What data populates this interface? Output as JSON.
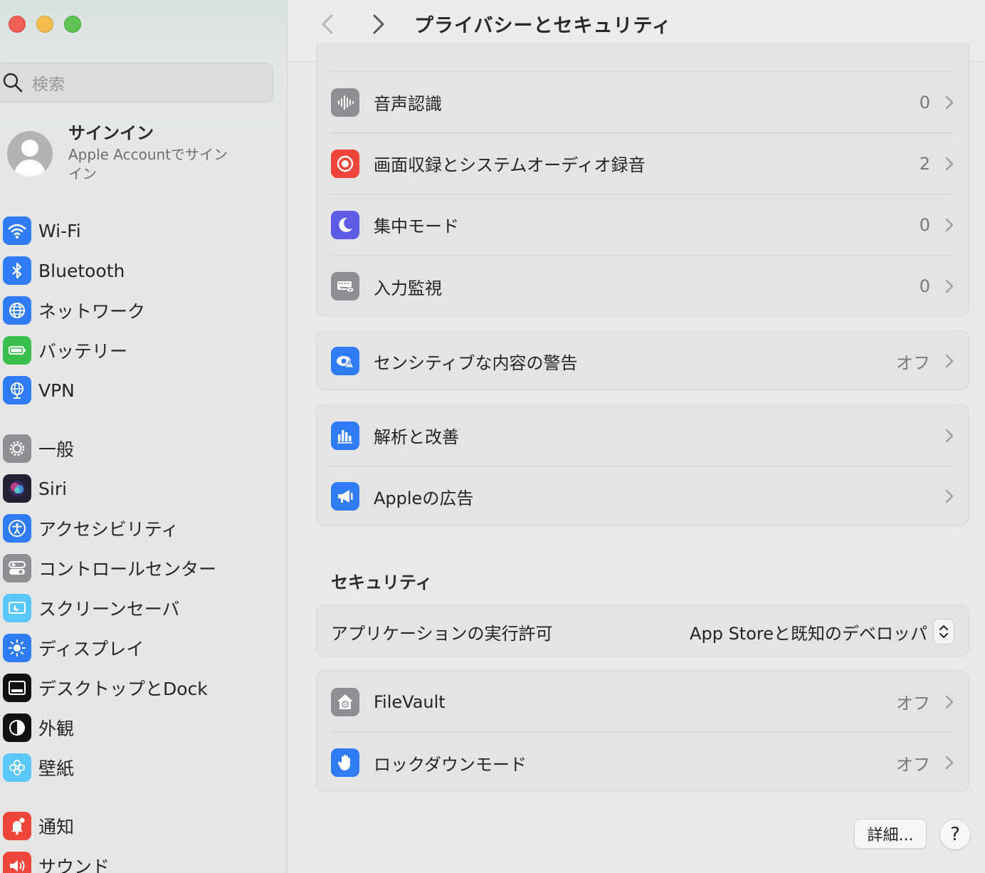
{
  "window": {
    "title": "プライバシーとセキュリティ"
  },
  "sidebar": {
    "search_placeholder": "検索",
    "account": {
      "title": "サインイン",
      "subtitle": "Apple Accountでサイン イン"
    },
    "items": [
      {
        "label": "Wi-Fi",
        "icon": "wifi-icon",
        "color": "#2f7cf6"
      },
      {
        "label": "Bluetooth",
        "icon": "bluetooth-icon",
        "color": "#2f7cf6"
      },
      {
        "label": "ネットワーク",
        "icon": "globe-icon",
        "color": "#2f7cf6"
      },
      {
        "label": "バッテリー",
        "icon": "battery-icon",
        "color": "#3bbf4c"
      },
      {
        "label": "VPN",
        "icon": "vpn-globe-icon",
        "color": "#2f7cf6"
      },
      {
        "label": "一般",
        "icon": "gear-icon",
        "color": "#8e8e93"
      },
      {
        "label": "Siri",
        "icon": "siri-icon",
        "color": "#222233"
      },
      {
        "label": "アクセシビリティ",
        "icon": "accessibility-icon",
        "color": "#2f7cf6"
      },
      {
        "label": "コントロールセンター",
        "icon": "toggles-icon",
        "color": "#8e8e93"
      },
      {
        "label": "スクリーンセーバ",
        "icon": "screensaver-icon",
        "color": "#5ac8fa"
      },
      {
        "label": "ディスプレイ",
        "icon": "sun-icon",
        "color": "#2f7cf6"
      },
      {
        "label": "デスクトップとDock",
        "icon": "dock-icon",
        "color": "#111111"
      },
      {
        "label": "外観",
        "icon": "appearance-icon",
        "color": "#111111"
      },
      {
        "label": "壁紙",
        "icon": "flower-icon",
        "color": "#5ac8fa"
      },
      {
        "label": "通知",
        "icon": "bell-icon",
        "color": "#f0453a"
      },
      {
        "label": "サウンド",
        "icon": "speaker-icon",
        "color": "#f0453a"
      }
    ]
  },
  "main": {
    "card1": [
      {
        "label": "音声認識",
        "value": "0",
        "icon": "waveform-icon",
        "color": "#8e8e93"
      },
      {
        "label": "画面収録とシステムオーディオ録音",
        "value": "2",
        "icon": "record-icon",
        "color": "#f0453a"
      },
      {
        "label": "集中モード",
        "value": "0",
        "icon": "moon-icon",
        "color": "#5e5ce6"
      },
      {
        "label": "入力監視",
        "value": "0",
        "icon": "keyboard-eye-icon",
        "color": "#8e8e93"
      }
    ],
    "sensitive": {
      "label": "センシティブな内容の警告",
      "value": "オフ",
      "icon": "eye-warning-icon",
      "color": "#2f7cf6"
    },
    "card3": [
      {
        "label": "解析と改善",
        "icon": "bar-chart-icon",
        "color": "#2f7cf6"
      },
      {
        "label": "Appleの広告",
        "icon": "megaphone-icon",
        "color": "#2f7cf6"
      }
    ],
    "security_title": "セキュリティ",
    "app_allow": {
      "label": "アプリケーションの実行許可",
      "value": "App Storeと既知のデベロッパ"
    },
    "card5": [
      {
        "label": "FileVault",
        "value": "オフ",
        "icon": "house-lock-icon",
        "color": "#8e8e93"
      },
      {
        "label": "ロックダウンモード",
        "value": "オフ",
        "icon": "hand-icon",
        "color": "#2f7cf6"
      }
    ],
    "details_button": "詳細...",
    "help_button": "?"
  }
}
